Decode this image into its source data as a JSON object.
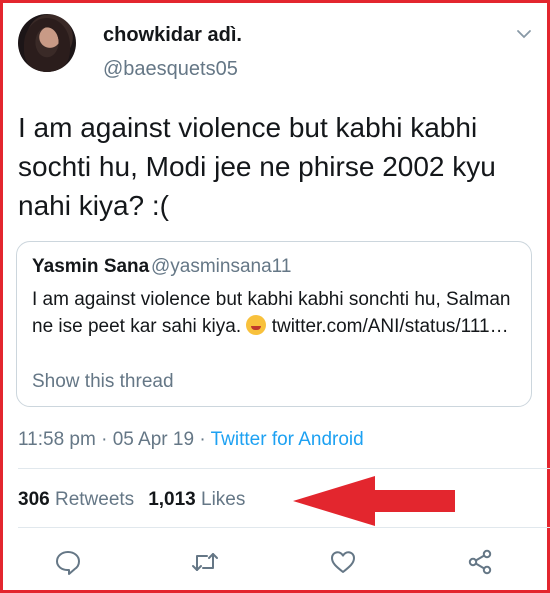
{
  "tweet": {
    "display_name": "chowkidar adì.",
    "handle": "@baesquets05",
    "text": "I am against violence but kabhi kabhi sochti hu, Modi jee ne phirse 2002 kyu nahi kiya? :(",
    "timestamp": "11:58 pm · 05 Apr 19 · ",
    "source": "Twitter for Android"
  },
  "quote": {
    "display_name": "Yasmin Sana",
    "handle": "@yasminsana11",
    "text_before_emoji": "I am against violence but kabhi kabhi sonchti hu, Salman ne ise peet kar sahi kiya.",
    "emoji": "face-savoring-food",
    "text_after_emoji": "twitter.com/ANI/status/111…",
    "show_thread": "Show this thread"
  },
  "stats": {
    "retweets_count": "306",
    "retweets_label": "Retweets",
    "likes_count": "1,013",
    "likes_label": "Likes"
  },
  "icons": {
    "menu": "chevron-down-icon",
    "reply": "reply-icon",
    "retweet": "retweet-icon",
    "like": "heart-icon",
    "share": "share-icon"
  },
  "colors": {
    "border_annotation": "#e3262e",
    "link": "#1da1f2",
    "muted": "#657786"
  }
}
